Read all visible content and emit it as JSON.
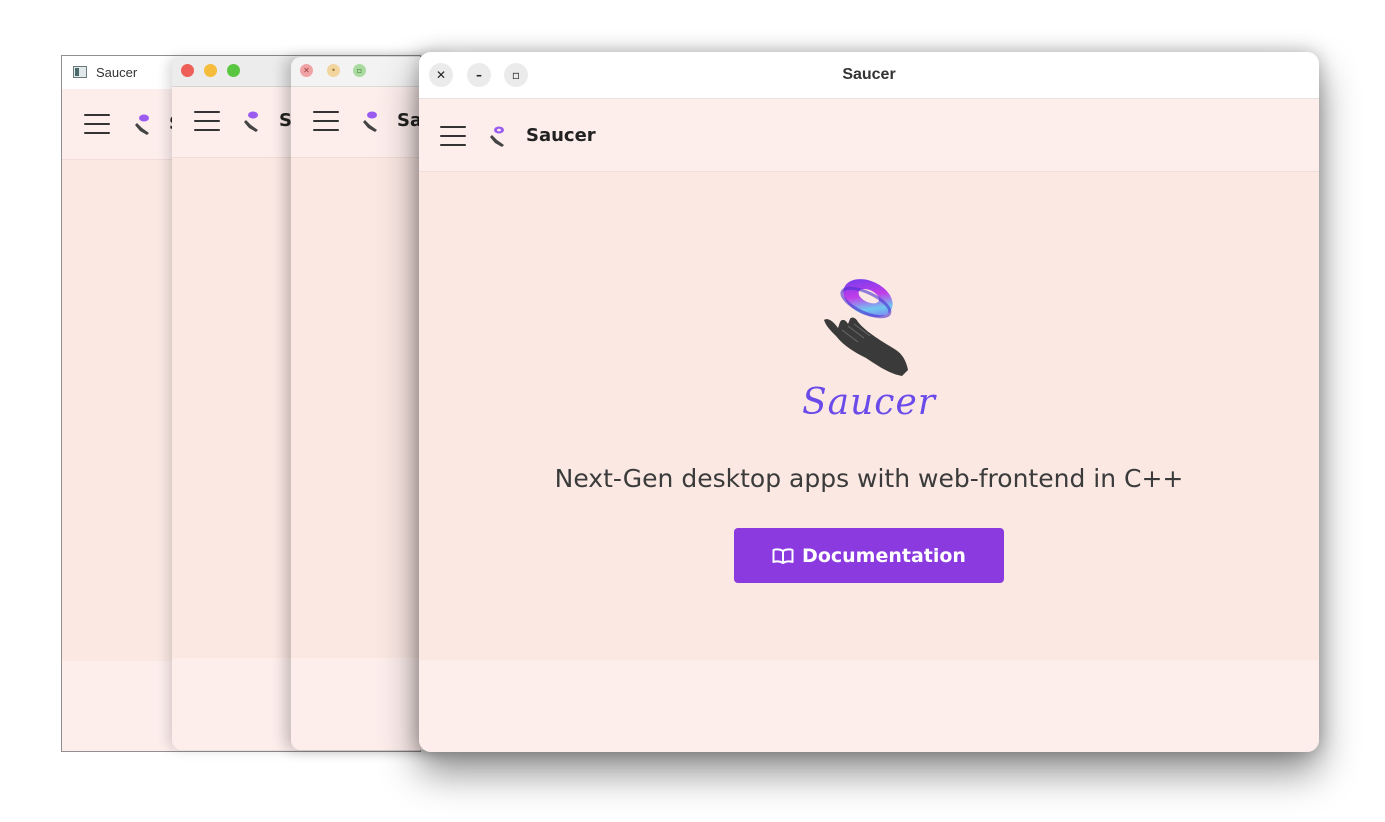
{
  "windows": {
    "win_a": {
      "title": "Saucer",
      "brand": "S"
    },
    "win_b": {
      "brand": "S"
    },
    "win_c": {
      "brand": "Sa"
    },
    "win_d": {
      "title": "Saucer",
      "brand": "Saucer",
      "close_glyph": "✕",
      "minimize_glyph": "–",
      "maximize_glyph": "▫"
    }
  },
  "hero": {
    "wordmark": "Saucer",
    "tagline": "Next-Gen desktop apps with web-frontend in C++",
    "button_label": "Documentation"
  },
  "colors": {
    "accent": "#8b3ae0",
    "wordmark": "#6a4bea",
    "header_bg": "#fdeeec",
    "main_bg": "#fbe8e3",
    "mac_close": "#ed5f57",
    "mac_minimize": "#f5bd3b",
    "mac_zoom": "#5bc641"
  },
  "icons": {
    "logo": "saucer-hand-icon",
    "menu": "hamburger-menu-icon",
    "docs": "book-open-icon"
  }
}
